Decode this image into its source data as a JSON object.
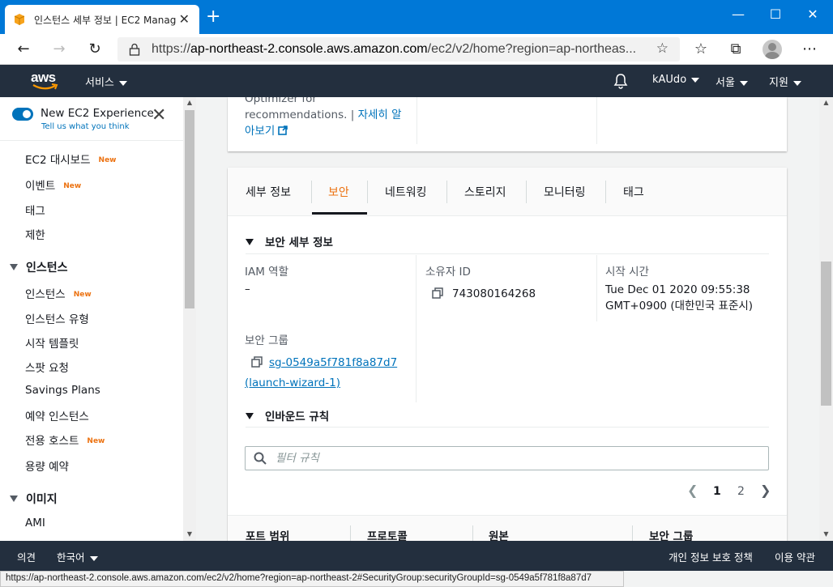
{
  "browser": {
    "tab_title": "인스턴스 세부 정보 | EC2 Manag",
    "url_prefix": "https://",
    "url_host": "ap-northeast-2.console.aws.amazon.com",
    "url_path": "/ec2/v2/home?region=ap-northeas...",
    "status_url": "https://ap-northeast-2.console.aws.amazon.com/ec2/v2/home?region=ap-northeast-2#SecurityGroup:securityGroupId=sg-0549a5f781f8a87d7"
  },
  "aws_header": {
    "logo": "aws",
    "services": "서비스",
    "account": "kAUdo",
    "region": "서울",
    "support": "지원"
  },
  "sidebar": {
    "experience_title": "New EC2 Experience",
    "experience_sub": "Tell us what you think",
    "new_badge": "New",
    "items": [
      {
        "label": "EC2 대시보드",
        "new": true
      },
      {
        "label": "이벤트",
        "new": true
      },
      {
        "label": "태그",
        "new": false
      },
      {
        "label": "제한",
        "new": false
      }
    ],
    "instances_header": "인스턴스",
    "instance_items": [
      {
        "label": "인스턴스",
        "new": true
      },
      {
        "label": "인스턴스 유형",
        "new": false
      },
      {
        "label": "시작 템플릿",
        "new": false
      },
      {
        "label": "스팟 요청",
        "new": false
      },
      {
        "label": "Savings Plans",
        "new": false
      },
      {
        "label": "예약 인스턴스",
        "new": false
      },
      {
        "label": "전용 호스트",
        "new": true
      },
      {
        "label": "용량 예약",
        "new": false
      }
    ],
    "images_header": "이미지",
    "image_items": [
      {
        "label": "AMI"
      }
    ]
  },
  "top_card": {
    "rec_text": "Optimizer for recommendations. |",
    "rec_link": "자세히 알아보기"
  },
  "detail": {
    "tabs": [
      "세부 정보",
      "보안",
      "네트워킹",
      "스토리지",
      "모니터링",
      "태그"
    ],
    "active_tab": "보안",
    "security_section": "보안 세부 정보",
    "iam_label": "IAM 역할",
    "iam_value": "–",
    "owner_label": "소유자 ID",
    "owner_value": "743080164268",
    "launch_label": "시작 시간",
    "launch_value_1": "Tue Dec 01 2020 09:55:38",
    "launch_value_2": "GMT+0900 (대한민국 표준시)",
    "sg_label": "보안 그룹",
    "sg_id": "sg-0549a5f781f8a87d7",
    "sg_name": "(launch-wizard-1)",
    "inbound_section": "인바운드 규칙",
    "filter_placeholder": "필터 규칙",
    "pages": [
      "1",
      "2"
    ],
    "columns": [
      "포트 범위",
      "프로토콜",
      "원본",
      "보안 그룹"
    ]
  },
  "footer": {
    "feedback": "의견",
    "language": "한국어",
    "privacy": "개인 정보 보호 정책",
    "terms": "이용 약관"
  },
  "colors": {
    "browser_accent": "#0078d7",
    "aws_nav": "#232f3e",
    "link": "#0073bb",
    "new_badge": "#ec7211"
  }
}
